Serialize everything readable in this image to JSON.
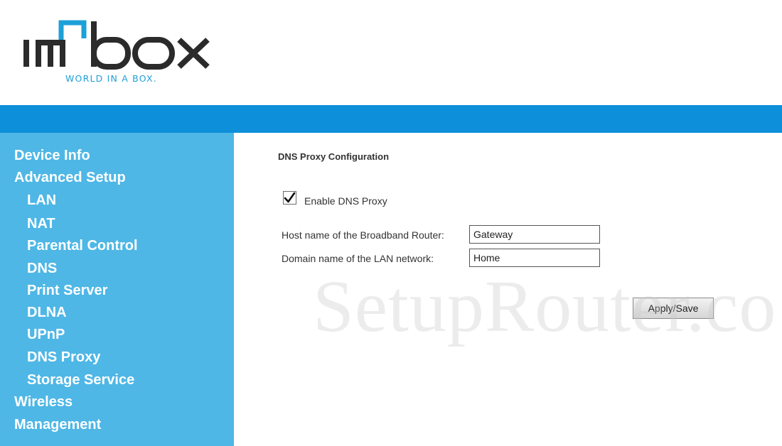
{
  "brand": {
    "logo_text": "imbox",
    "tagline": "WORLD IN A BOX."
  },
  "colors": {
    "accent_band": "#0d8fd9",
    "sidebar_bg": "#4eb7e6",
    "logo_dark": "#2b2b2b",
    "logo_accent": "#1ea0d8"
  },
  "sidebar": {
    "items": [
      {
        "label": "Device Info",
        "level": 0
      },
      {
        "label": "Advanced Setup",
        "level": 0
      },
      {
        "label": "LAN",
        "level": 1
      },
      {
        "label": "NAT",
        "level": 1
      },
      {
        "label": "Parental Control",
        "level": 1
      },
      {
        "label": "DNS",
        "level": 1
      },
      {
        "label": "Print Server",
        "level": 1
      },
      {
        "label": "DLNA",
        "level": 1
      },
      {
        "label": "UPnP",
        "level": 1
      },
      {
        "label": "DNS Proxy",
        "level": 1
      },
      {
        "label": "Storage Service",
        "level": 1
      },
      {
        "label": "Wireless",
        "level": 0
      },
      {
        "label": "Management",
        "level": 0
      }
    ]
  },
  "main": {
    "title": "DNS Proxy Configuration",
    "enable": {
      "label": "Enable DNS Proxy",
      "checked": true
    },
    "host_name": {
      "label": "Host name of the Broadband Router:",
      "value": "Gateway"
    },
    "domain_name": {
      "label": "Domain name of the LAN network:",
      "value": "Home"
    },
    "apply_label": "Apply/Save"
  },
  "watermark": "SetupRouter.co"
}
